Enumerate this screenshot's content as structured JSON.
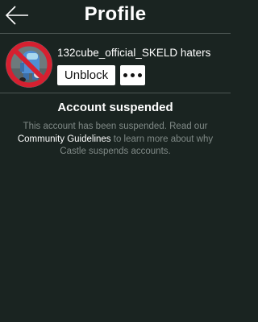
{
  "header": {
    "title": "Profile",
    "back_icon": "arrow-left-icon"
  },
  "profile": {
    "username": "132cube_official_SKELD haters",
    "avatar_icon": "no-symbol-avatar",
    "unblock_label": "Unblock",
    "more_icon": "ellipsis-icon"
  },
  "suspension": {
    "title": "Account suspended",
    "message_before": "This account has been suspended. Read our",
    "link_text": "Community Guidelines",
    "message_after": "to learn more about why Castle suspends accounts."
  },
  "colors": {
    "background": "#1a2421",
    "divider": "#4c5653",
    "muted_text": "#808a87",
    "prohibit_red": "#d62030"
  }
}
